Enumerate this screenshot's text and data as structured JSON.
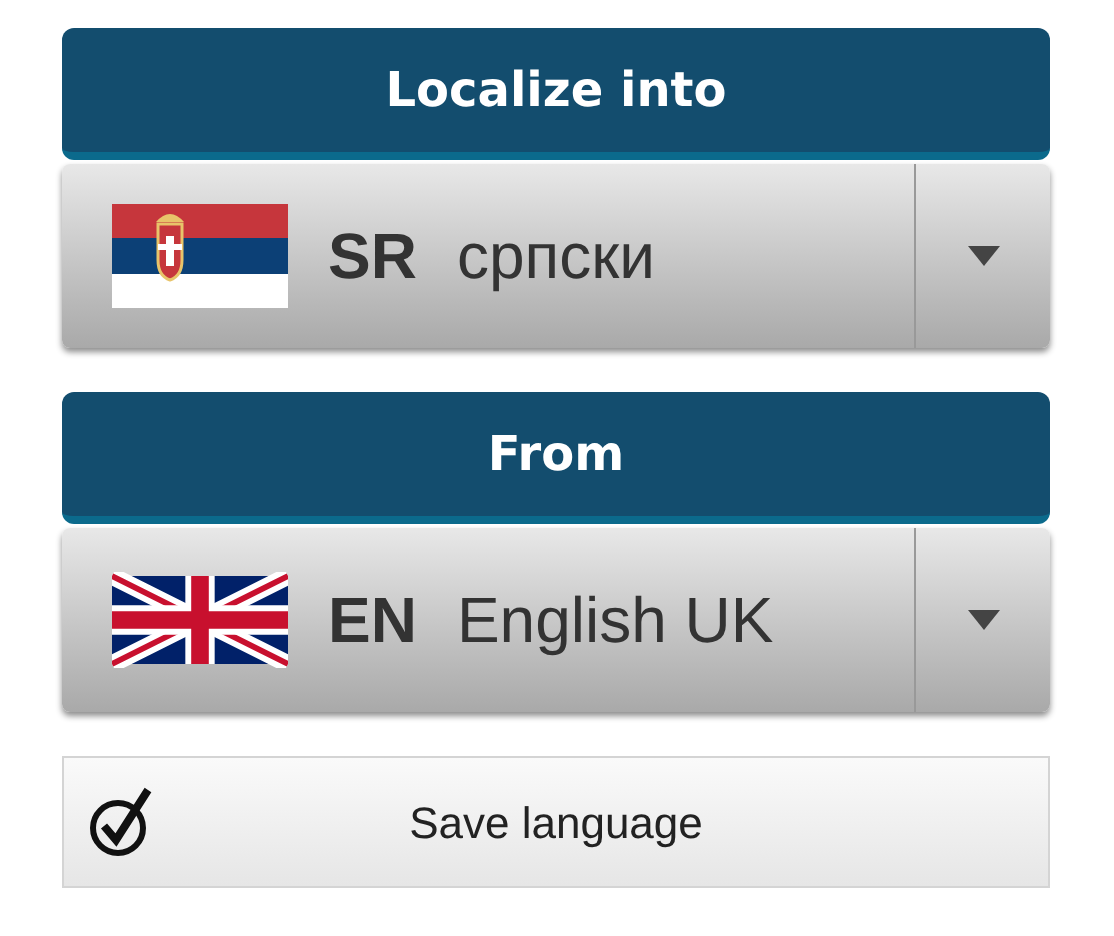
{
  "sections": [
    {
      "heading": "Localize into",
      "flag": {
        "kind": "serbia"
      },
      "code": "SR",
      "language": "српски"
    },
    {
      "heading": "From",
      "flag": {
        "kind": "uk"
      },
      "code": "EN",
      "language": "English UK"
    }
  ],
  "save": {
    "label": "Save language",
    "checked": true
  }
}
